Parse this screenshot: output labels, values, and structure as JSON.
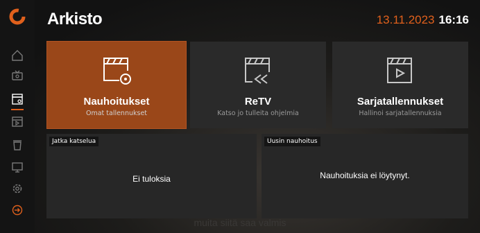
{
  "header": {
    "title": "Arkisto",
    "date": "13.11.2023",
    "time": "16:16"
  },
  "sidebar": {
    "items": [
      {
        "icon": "home-icon"
      },
      {
        "icon": "tv-icon"
      },
      {
        "icon": "archive-icon",
        "active": true
      },
      {
        "icon": "calendar-icon"
      },
      {
        "icon": "trash-icon"
      },
      {
        "icon": "monitor-icon"
      },
      {
        "icon": "gear-icon"
      },
      {
        "icon": "logout-icon"
      }
    ]
  },
  "tiles": [
    {
      "label": "Nauhoitukset",
      "subtitle": "Omat tallennukset",
      "icon": "recordings-icon",
      "active": true
    },
    {
      "label": "ReTV",
      "subtitle": "Katso jo tulleita ohjelmia",
      "icon": "rewind-clapper-icon"
    },
    {
      "label": "Sarjatallennukset",
      "subtitle": "Hallinoi sarjatallennuksia",
      "icon": "play-clapper-icon"
    }
  ],
  "panels": [
    {
      "tag": "Jatka katselua",
      "message": "Ei tuloksia"
    },
    {
      "tag": "Uusin nauhoitus",
      "message": "Nauhoituksia ei löytynyt."
    }
  ],
  "background_subtitle": "muita siitä saa valmis",
  "colors": {
    "accent": "#e0601c",
    "active_tile": "#9a4719",
    "tile": "#2a2a2a"
  }
}
